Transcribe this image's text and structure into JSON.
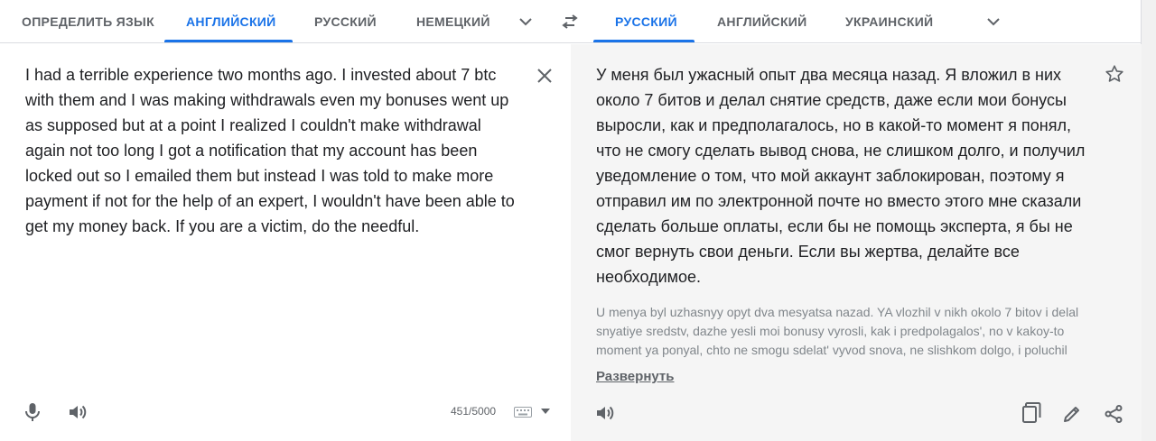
{
  "source_langs": {
    "tabs": [
      {
        "label": "ОПРЕДЕЛИТЬ ЯЗЫК",
        "active": false
      },
      {
        "label": "АНГЛИЙСКИЙ",
        "active": true
      },
      {
        "label": "РУССКИЙ",
        "active": false
      },
      {
        "label": "НЕМЕЦКИЙ",
        "active": false
      }
    ],
    "more_icon": "chevron-down-icon"
  },
  "swap_icon": "swap-icon",
  "target_langs": {
    "tabs": [
      {
        "label": "РУССКИЙ",
        "active": true
      },
      {
        "label": "АНГЛИЙСКИЙ",
        "active": false
      },
      {
        "label": "УКРАИНСКИЙ",
        "active": false
      }
    ],
    "more_icon": "chevron-down-icon"
  },
  "source": {
    "text": "I had a terrible experience two months ago. I invested about 7 btc with them and I was making withdrawals even my bonuses went up as supposed but at a point I realized I couldn't make withdrawal again not too long I got a notification that my account has been locked out so I emailed them but instead I was told to make more payment if not for the help of an expert, I wouldn't have been able to get my money back. If you are a victim, do the needful.",
    "char_count": "451/5000",
    "icons": [
      "close-icon",
      "microphone-icon",
      "speaker-icon",
      "keyboard-icon"
    ]
  },
  "target": {
    "text": "У меня был ужасный опыт два месяца назад. Я вложил в них около 7 битов и делал снятие средств, даже если мои бонусы выросли, как и предполагалось, но в какой-то момент я понял, что не смогу сделать вывод снова, не слишком долго, и получил уведомление о том, что мой аккаунт заблокирован, поэтому я отправил им по электронной почте но вместо этого мне сказали сделать больше оплаты, если бы не помощь эксперта, я бы не смог вернуть свои деньги. Если вы жертва, делайте все необходимое.",
    "transliteration": "U menya byl uzhasnyy opyt dva mesyatsa nazad. YA vlozhil v nikh okolo 7 bitov i delal snyatiye sredstv, dazhe yesli moi bonusy vyrosli, kak i predpolagalos', no v kakoy-to moment ya ponyal, chto ne smogu sdelat' vyvod snova, ne slishkom dolgo, i poluchil",
    "expand_label": "Развернуть",
    "icons": [
      "star-icon",
      "speaker-icon",
      "copy-icon",
      "edit-icon",
      "share-icon"
    ]
  },
  "colors": {
    "accent": "#1a73e8",
    "target_bg": "#f5f5f5",
    "muted_text": "#5f6368"
  }
}
